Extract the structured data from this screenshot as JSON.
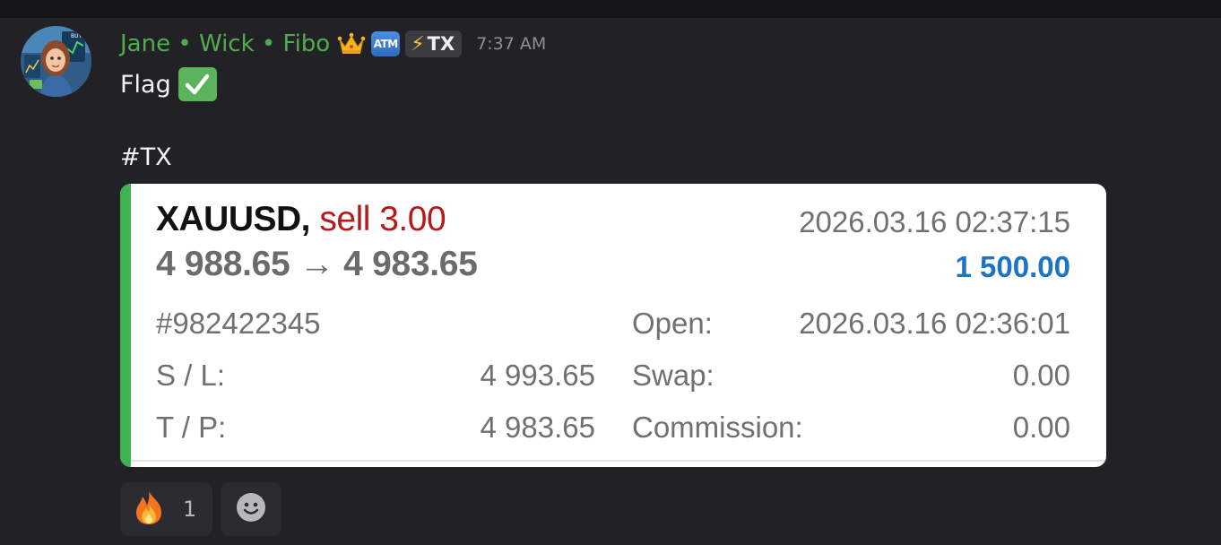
{
  "message": {
    "author": {
      "name": "Jane • Wick • Fibo",
      "avatar_icon": "trader-avatar",
      "badges": [
        "crown-icon",
        "atm-icon"
      ],
      "atm_label": "ATM",
      "tag": {
        "icon": "lightning-icon",
        "label": "TX"
      },
      "color": "#4fad4f"
    },
    "timestamp": "7:37 AM",
    "lines": {
      "text1": "Flag",
      "text1_emoji": "check-mark-button",
      "text2": "#TX"
    }
  },
  "trade_card": {
    "accent_color": "#3fb34f",
    "symbol": "XAUUSD,",
    "action": "sell 3.00",
    "price_move": "4 988.65 → 4 983.65",
    "close_time": "2026.03.16 02:37:15",
    "profit": "1 500.00",
    "order_id": "#982422345",
    "sl_label": "S / L:",
    "sl_value": "4 993.65",
    "tp_label": "T / P:",
    "tp_value": "4 983.65",
    "open_label": "Open:",
    "open_value": "2026.03.16 02:36:01",
    "swap_label": "Swap:",
    "swap_value": "0.00",
    "commission_label": "Commission:",
    "commission_value": "0.00"
  },
  "reactions": [
    {
      "icon": "fire-icon",
      "count": "1"
    }
  ],
  "add_reaction_icon": "smiley-icon"
}
